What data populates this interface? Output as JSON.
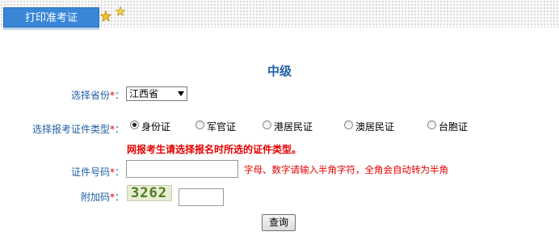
{
  "tabs": {
    "active_label": "打印准考证"
  },
  "page_title": "中级",
  "form": {
    "province": {
      "label": "选择省份",
      "required_mark": "*",
      "colon": "：",
      "value": "江西省"
    },
    "id_type": {
      "label": "选择报考证件类型",
      "required_mark": "*",
      "colon": "：",
      "options": [
        "身份证",
        "军官证",
        "港居民证",
        "澳居民证",
        "台胞证"
      ],
      "selected": "身份证"
    },
    "warning": "网报考生请选择报名时所选的证件类型。",
    "id_number": {
      "label": "证件号码",
      "required_mark": "*",
      "colon": "：",
      "value": "",
      "hint": "字母、数字请输入半角字符，全角会自动转为半角"
    },
    "captcha": {
      "label": "附加码",
      "required_mark": "*",
      "colon": "：",
      "image_text": "3262",
      "value": ""
    },
    "submit_label": "查询"
  },
  "colors": {
    "tab_blue": "#3a87d8",
    "label_blue": "#2160a8",
    "warning_red": "#e60000"
  }
}
